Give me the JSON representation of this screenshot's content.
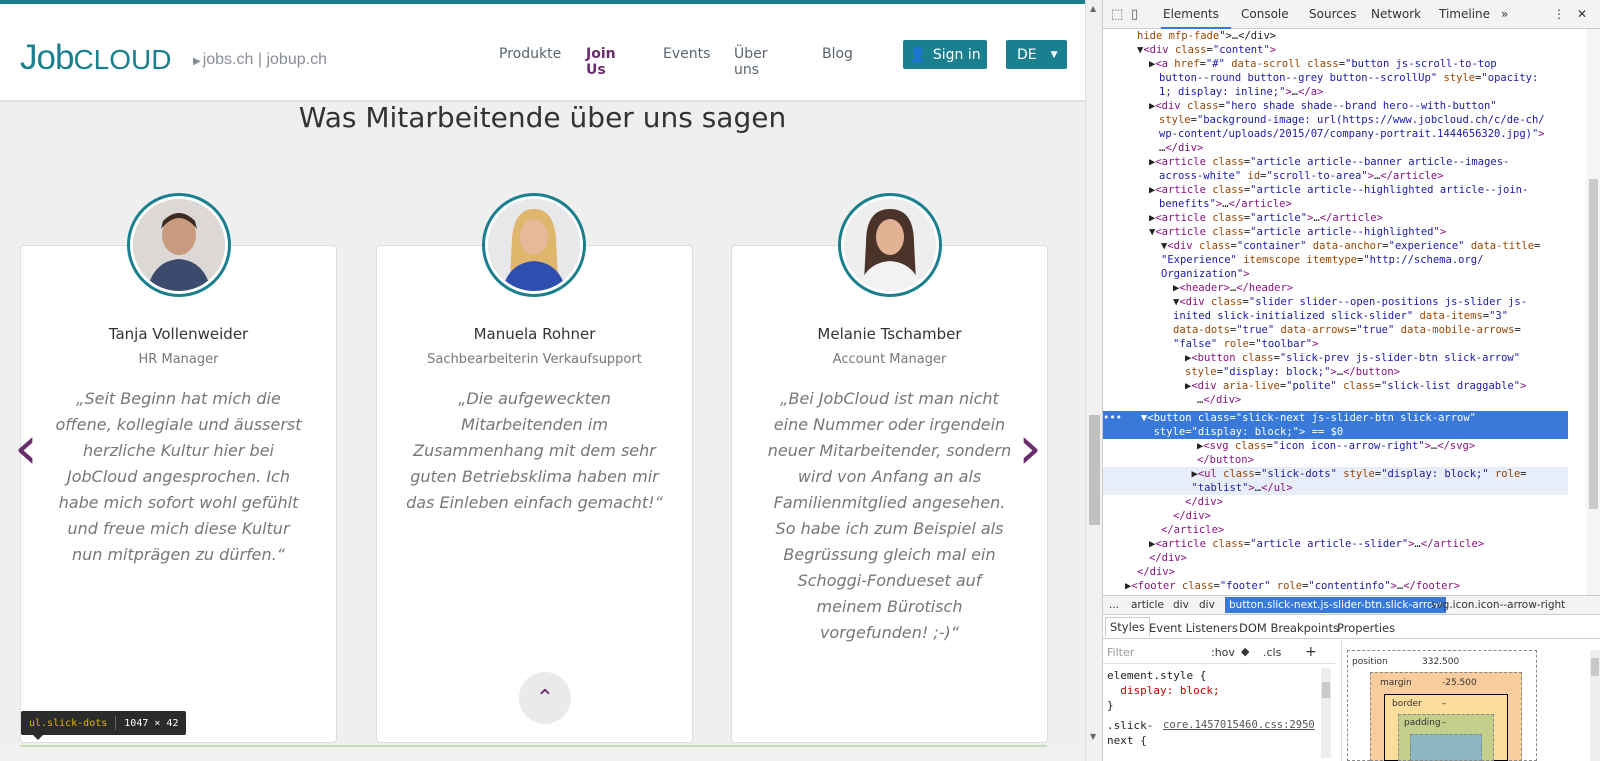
{
  "header": {
    "logo_main": "Job",
    "logo_cloud": "CLOUD",
    "sublogo_jobs": "jobs.ch",
    "sublogo_sep": "|",
    "sublogo_jobup": "jobup.ch",
    "nav": [
      "Produkte",
      "Join Us",
      "Events",
      "Über uns",
      "Blog"
    ],
    "nav_active": "Join Us",
    "signin_label": "Sign in",
    "lang_label": "DE"
  },
  "section": {
    "heading": "Was Mitarbeitende über uns sagen",
    "cards": [
      {
        "name": "Tanja Vollenweider",
        "role": "HR Manager",
        "quote_lines": [
          "„Seit Beginn hat mich die",
          "offene, kollegiale und äusserst",
          "herzliche Kultur hier bei",
          "JobCloud angesprochen. Ich",
          "habe mich sofort wohl gefühlt",
          "und freue mich diese Kultur",
          "nun mitprägen zu dürfen.“"
        ]
      },
      {
        "name": "Manuela Rohner",
        "role": "Sachbearbeiterin Verkaufsupport",
        "quote_lines": [
          "„Die aufgeweckten",
          "Mitarbeitenden im",
          "Zusammenhang mit dem sehr",
          "guten Betriebsklima haben mir",
          "das Einleben einfach gemacht!“"
        ]
      },
      {
        "name": "Melanie Tschamber",
        "role": "Account Manager",
        "quote_lines": [
          "„Bei JobCloud ist man nicht",
          "eine Nummer oder irgendein",
          "neuer Mitarbeitender, sondern",
          "wird von Anfang an als",
          "Familienmitglied angesehen.",
          "So habe ich zum Beispiel als",
          "Begrüssung gleich mal ein",
          "Schoggi-Fondueset auf",
          "meinem Bürotisch",
          "vorgefunden! ;-)“"
        ]
      }
    ],
    "prev_arrow": "‹",
    "next_arrow": "›",
    "scroll_up": "⌃"
  },
  "tooltip": {
    "selector": "ul.slick-dots",
    "size": "1047 × 42"
  },
  "devtools": {
    "tabs": [
      "Elements",
      "Console",
      "Sources",
      "Network",
      "Timeline"
    ],
    "active_tab": "Elements",
    "more": "»",
    "menu": "⋮",
    "close": "✕",
    "breadcrumbs": [
      "...",
      "article",
      "div",
      "div",
      "button.slick-next.js-slider-btn.slick-arrow",
      "svg.icon.icon--arrow-right"
    ],
    "breadcrumb_active": "button.slick-next.js-slider-btn.slick-arrow",
    "styles_tabs": [
      "Styles",
      "Event Listeners",
      "DOM Breakpoints",
      "Properties"
    ],
    "filter_placeholder": "Filter",
    "filter_hov": ":hov",
    "filter_cls": ".cls",
    "filter_add": "+",
    "style_lines": [
      "element.style {",
      "  display: block;",
      "}",
      ".slick-",
      "next {"
    ],
    "style_source": "core.1457015460.css:2950",
    "boxmodel": {
      "position_label": "position",
      "position_value": "332.500",
      "margin_label": "margin",
      "margin_value": "-25.500",
      "border_label": "border",
      "border_value": "–",
      "padding_label": "padding",
      "padding_value": "–"
    }
  },
  "colors": {
    "brand": "#1a7f8e",
    "accent": "#6b2c6e",
    "selection": "#3879d9"
  }
}
